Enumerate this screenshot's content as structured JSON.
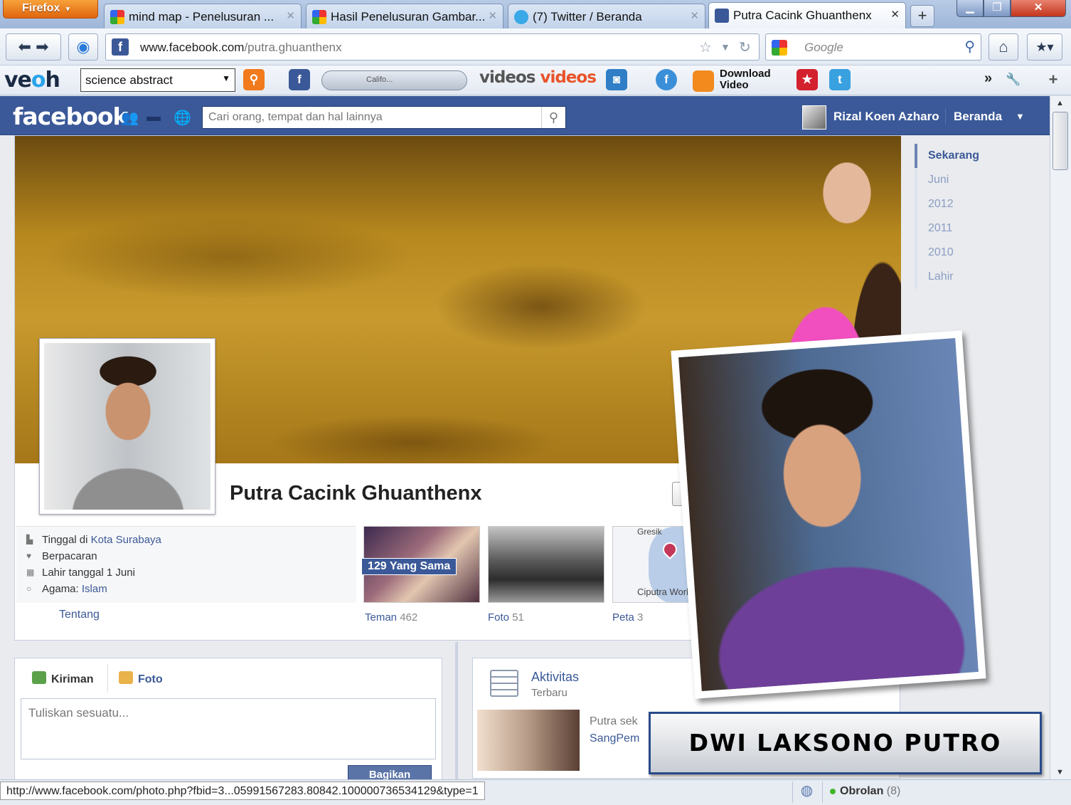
{
  "browser": {
    "menu_button": "Firefox",
    "tabs": [
      {
        "label": "mind map - Penelusuran ...",
        "icon": "google-icon"
      },
      {
        "label": "Hasil Penelusuran Gambar...",
        "icon": "google-icon"
      },
      {
        "label": "(7) Twitter / Beranda",
        "icon": "twitter-icon"
      },
      {
        "label": "Putra Cacink Ghuanthenx",
        "icon": "facebook-icon"
      }
    ],
    "url_domain": "www.facebook.com",
    "url_path": "/putra.ghuanthenx",
    "search_placeholder": "Google",
    "toolbar_search_value": "science abstract",
    "toolbar_player_text": "Califo...",
    "toolbar_download_label_1": "Download",
    "toolbar_download_label_2": "Video",
    "status_url": "http://www.facebook.com/photo.php?fbid=3...05991567283.80842.100000736534129&type=1"
  },
  "facebook": {
    "logo": "facebook",
    "search_placeholder": "Cari orang, tempat dan hal lainnya",
    "user_name": "Rizal Koen Azharo",
    "home_label": "Beranda",
    "profile_name": "Putra Cacink Ghuanthenx",
    "about": [
      {
        "prefix": "Tinggal di ",
        "link": "Kota Surabaya"
      },
      {
        "prefix": "Berpacaran",
        "link": ""
      },
      {
        "prefix": "Lahir tanggal 1 Juni",
        "link": ""
      },
      {
        "prefix": "Agama: ",
        "link": "Islam"
      }
    ],
    "about_tab": "Tentang",
    "friends_badge": "129 Yang Sama",
    "tiles": [
      {
        "label": "Teman",
        "count": "462"
      },
      {
        "label": "Foto",
        "count": "51"
      },
      {
        "label": "Peta",
        "count": "3"
      }
    ],
    "map_label_top": "Gresik",
    "map_label_bottom": "Ciputra Work",
    "composer_tab_post": "Kiriman",
    "composer_tab_photo": "Foto",
    "composer_placeholder": "Tuliskan sesuatu...",
    "composer_share": "Bagikan",
    "activity_title": "Aktivitas",
    "activity_subtitle": "Terbaru",
    "activity_text_1": "Putra sek",
    "activity_text_2": "SangPem",
    "timeline_nav": [
      "Sekarang",
      "Juni",
      "2012",
      "2011",
      "2010",
      "Lahir"
    ],
    "chat_label": "Obrolan",
    "chat_count": "(8)"
  },
  "overlay": {
    "caption": "DWI LAKSONO PUTRO"
  },
  "colors": {
    "facebook_blue": "#3b5998",
    "firefox_orange": "#e0650e",
    "caption_border": "#2a4a8a"
  }
}
